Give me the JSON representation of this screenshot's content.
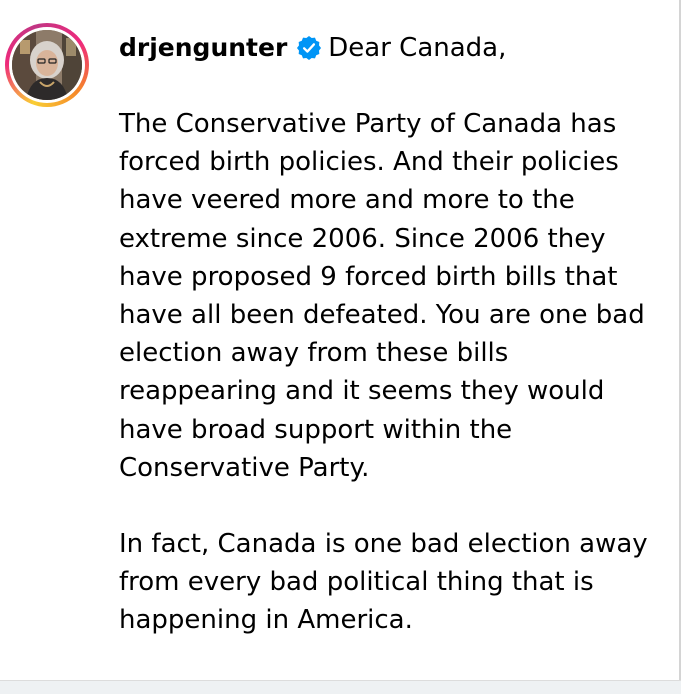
{
  "post": {
    "username": "drjengunter",
    "verified_icon": "verified-badge-icon",
    "greeting": "Dear Canada,",
    "paragraphs": [
      "The Conservative Party of Canada has forced birth policies. And their policies have veered more and more to the extreme since 2006. Since 2006 they have proposed 9 forced birth bills that have all been defeated. You are one bad election away from these bills reappearing and it seems they would have broad support within the Conservative Party.",
      "In fact, Canada is one bad election away from every bad political thing that is happening in America."
    ]
  },
  "colors": {
    "text": "#000000",
    "verified_badge": "#0095f6",
    "ring_gradient": [
      "#f9ce34",
      "#ee2a7b",
      "#c13584",
      "#f58529"
    ],
    "footer_bg": "#eef1f3"
  }
}
